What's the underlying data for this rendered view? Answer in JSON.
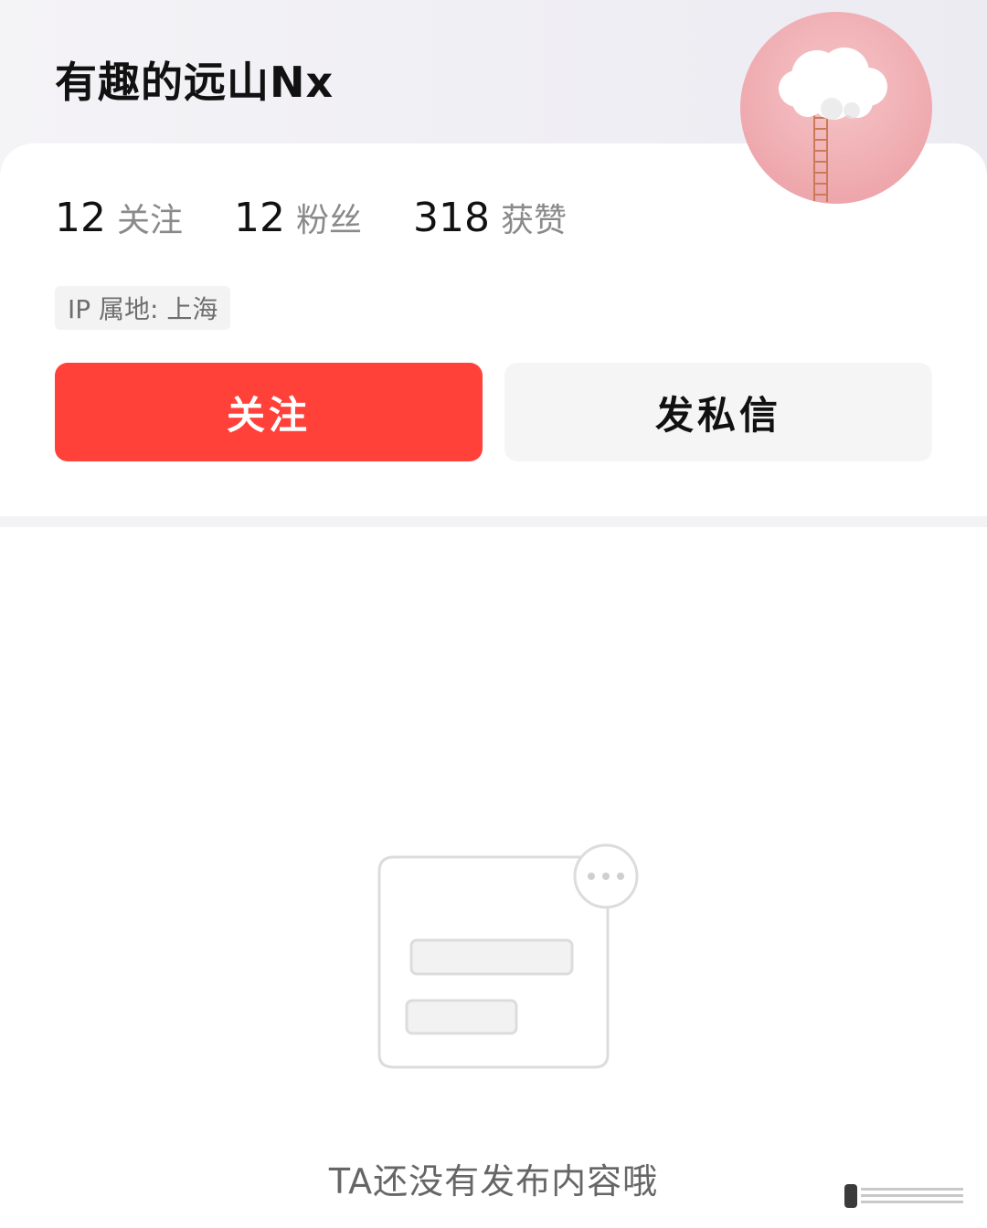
{
  "profile": {
    "username": "有趣的远山Nx",
    "avatar_icon": "cloud-ladder-avatar",
    "stats": [
      {
        "value": "12",
        "label": "关注"
      },
      {
        "value": "12",
        "label": "粉丝"
      },
      {
        "value": "318",
        "label": "获赞"
      }
    ],
    "ip_location": "IP 属地: 上海"
  },
  "actions": {
    "follow_label": "关注",
    "message_label": "发私信"
  },
  "content": {
    "empty_icon": "empty-note-icon",
    "empty_text": "TA还没有发布内容哦"
  },
  "colors": {
    "follow_button": "#ff4139",
    "message_button": "#f5f5f5",
    "top_background": "#eeedf3"
  }
}
